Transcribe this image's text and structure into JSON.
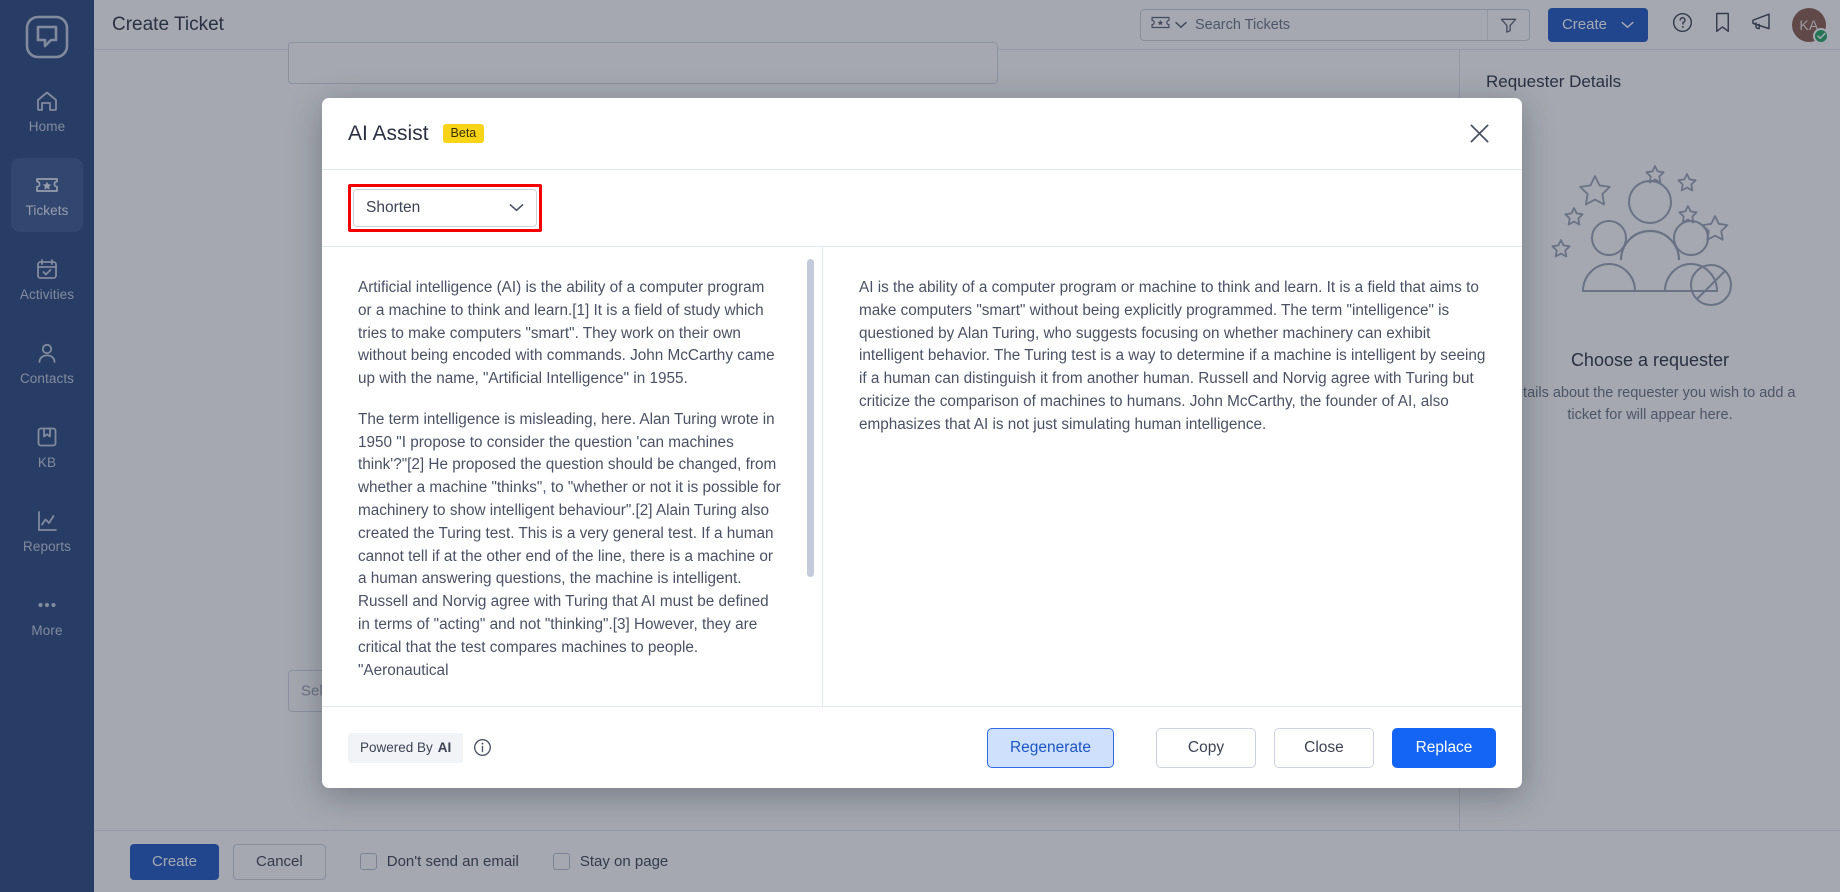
{
  "sidebar": {
    "logo_icon": "app-logo-icon",
    "items": [
      {
        "label": "Home",
        "icon": "home-icon",
        "active": false
      },
      {
        "label": "Tickets",
        "icon": "ticket-icon",
        "active": true
      },
      {
        "label": "Activities",
        "icon": "calendar-check-icon",
        "active": false
      },
      {
        "label": "Contacts",
        "icon": "person-icon",
        "active": false
      },
      {
        "label": "KB",
        "icon": "book-icon",
        "active": false
      },
      {
        "label": "Reports",
        "icon": "chart-line-icon",
        "active": false
      },
      {
        "label": "More",
        "icon": "ellipsis-icon",
        "active": false
      }
    ]
  },
  "topbar": {
    "page_title": "Create Ticket",
    "search": {
      "type_icon": "ticket-icon",
      "placeholder": "Search Tickets",
      "value": "",
      "filter_icon": "filter-icon"
    },
    "create_label": "Create",
    "help_icon": "question-circle-icon",
    "bookmark_icon": "bookmark-icon",
    "announcement_icon": "megaphone-icon",
    "avatar_initials": "KA"
  },
  "background_form": {
    "multiselect_placeholder": "Select one or more values"
  },
  "requester": {
    "title": "Requester Details",
    "empty_heading": "Choose a requester",
    "empty_text": "Details about the requester you wish to add a ticket for will appear here."
  },
  "bottombar": {
    "create_label": "Create",
    "cancel_label": "Cancel",
    "checkbox_no_email": "Don't send an email",
    "checkbox_stay": "Stay on page"
  },
  "modal": {
    "title": "AI Assist",
    "badge": "Beta",
    "close_icon": "close-icon",
    "action_select": {
      "value": "Shorten",
      "chevron_icon": "chevron-down-icon",
      "highlighted": true,
      "highlight_color": "#f50000"
    },
    "source_text": [
      "Artificial intelligence (AI) is the ability of a computer program or a machine to think and learn.[1] It is a field of study which tries to make computers \"smart\". They work on their own without being encoded with commands. John McCarthy came up with the name, \"Artificial Intelligence\" in 1955.",
      "The term intelligence is misleading, here. Alan Turing wrote in 1950 \"I propose to consider the question 'can machines think'?\"[2] He proposed the question should be changed, from whether a machine \"thinks\", to \"whether or not it is possible for machinery to show intelligent behaviour\".[2] Alain Turing also created the Turing test. This is a very general test. If a human cannot tell if at the other end of the line, there is a machine or a human answering questions, the machine is intelligent. Russell and Norvig agree with Turing that AI must be defined in terms of \"acting\" and not \"thinking\".[3] However, they are critical that the test compares machines to people. \"Aeronautical"
    ],
    "result_text": [
      "AI is the ability of a computer program or machine to think and learn. It is a field that aims to make computers \"smart\" without being explicitly programmed. The term \"intelligence\" is questioned by Alan Turing, who suggests focusing on whether machinery can exhibit intelligent behavior. The Turing test is a way to determine if a machine is intelligent by seeing if a human can distinguish it from another human. Russell and Norvig agree with Turing but criticize the comparison of machines to humans. John McCarthy, the founder of AI, also emphasizes that AI is not just simulating human intelligence."
    ],
    "footer": {
      "powered_prefix": "Powered By",
      "powered_strong": "AI",
      "info_icon": "info-circle-icon",
      "regenerate_label": "Regenerate",
      "copy_label": "Copy",
      "close_label": "Close",
      "replace_label": "Replace"
    }
  },
  "colors": {
    "sidebar_bg": "#28477e",
    "primary_blue": "#1c56c4",
    "replace_blue": "#1565f5",
    "beta_yellow": "#f8d316",
    "highlight_red": "#f50000"
  }
}
